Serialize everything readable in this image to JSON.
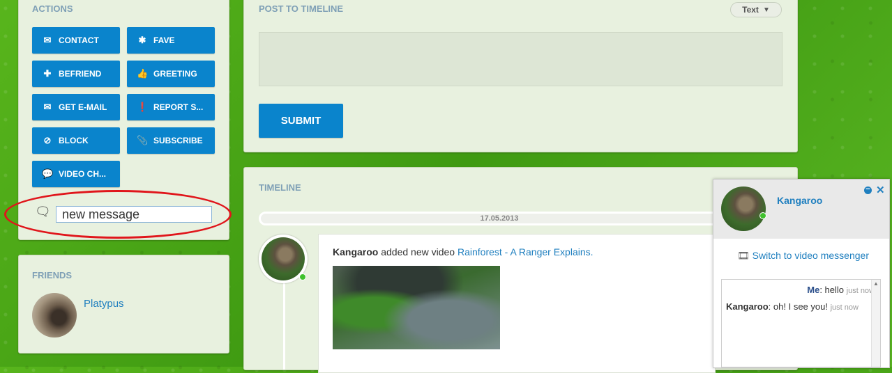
{
  "actions": {
    "title": "ACTIONS",
    "buttons": [
      {
        "label": "CONTACT",
        "icon": "envelope-icon"
      },
      {
        "label": "FAVE",
        "icon": "asterisk-icon"
      },
      {
        "label": "BEFRIEND",
        "icon": "plus-icon"
      },
      {
        "label": "GREETING",
        "icon": "thumbs-up-icon"
      },
      {
        "label": "GET E-MAIL",
        "icon": "mail-outline-icon"
      },
      {
        "label": "REPORT S...",
        "icon": "alert-icon"
      },
      {
        "label": "BLOCK",
        "icon": "ban-icon"
      },
      {
        "label": "SUBSCRIBE",
        "icon": "paperclip-icon"
      },
      {
        "label": "VIDEO CH...",
        "icon": "chat-bubbles-icon"
      }
    ],
    "message_input_value": "new message"
  },
  "friends": {
    "title": "FRIENDS",
    "items": [
      {
        "name": "Platypus"
      }
    ]
  },
  "post": {
    "title": "POST TO TIMELINE",
    "type_dropdown": "Text",
    "submit_label": "SUBMIT"
  },
  "timeline": {
    "title": "TIMELINE",
    "date": "17.05.2013",
    "entry": {
      "user": "Kangaroo",
      "action": " added new video ",
      "video_title": "Rainforest - A Ranger Explains."
    }
  },
  "messenger": {
    "contact_name": "Kangaroo",
    "switch_label": "Switch to video messenger",
    "messages": [
      {
        "author": "Me",
        "text": "hello",
        "time": "just now"
      },
      {
        "author": "Kangaroo",
        "text": "oh! I see you!",
        "time": "just now"
      }
    ]
  },
  "colors": {
    "accent": "#0a84cc",
    "link": "#1f7fbf",
    "highlight_ring": "#e0161b"
  }
}
